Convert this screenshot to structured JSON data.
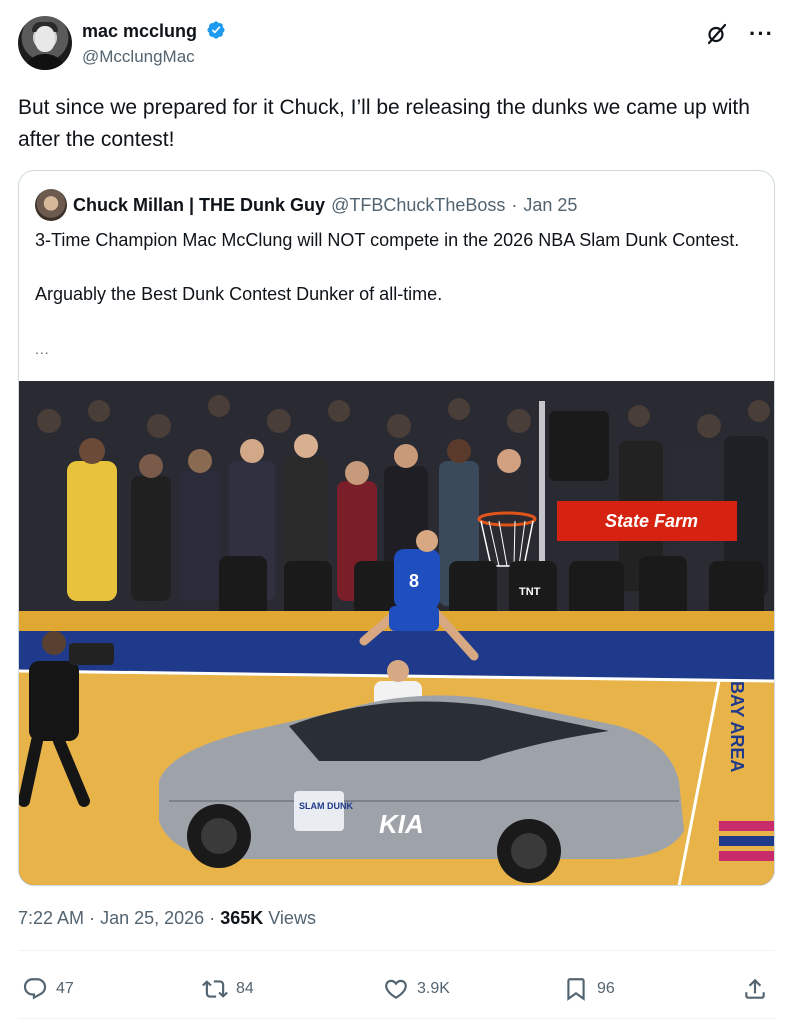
{
  "author": {
    "display_name": "mac mcclung",
    "handle": "@McclungMac",
    "verified": true,
    "verified_color": "#1d9bf0"
  },
  "header_icons": [
    "grok-icon",
    "more-icon"
  ],
  "more_label": "···",
  "tweet": {
    "text": "But since we prepared for it Chuck, I’ll be releasing the dunks we came up with after the contest!"
  },
  "quote": {
    "display_name": "Chuck Millan | THE Dunk Guy",
    "handle": "@TFBChuckTheBoss",
    "separator": "·",
    "date": "Jan 25",
    "paragraph1": "3-Time Champion Mac McClung will NOT compete in the 2026 NBA Slam Dunk Contest.",
    "paragraph2": "Arguably the Best Dunk Contest Dunker of all-time.",
    "ellipsis": "...",
    "image_text": {
      "sponsor": "State Farm",
      "jersey_number": "8",
      "car_brand": "KIA",
      "car_decal": "SLAM DUNK",
      "court_text": "BAY AREA",
      "broadcaster": "TNT"
    }
  },
  "meta": {
    "time": "7:22 AM",
    "separator": "·",
    "date": "Jan 25, 2026",
    "views_count": "365K",
    "views_label": "Views"
  },
  "actions": {
    "replies": "47",
    "reposts": "84",
    "likes": "3.9K",
    "bookmarks": "96"
  },
  "colors": {
    "text_primary": "#0f1419",
    "text_secondary": "#536471",
    "border": "#cfd9de",
    "divider": "#eff3f4",
    "state_farm_red": "#d62311",
    "magic_blue": "#1f4fbf"
  }
}
